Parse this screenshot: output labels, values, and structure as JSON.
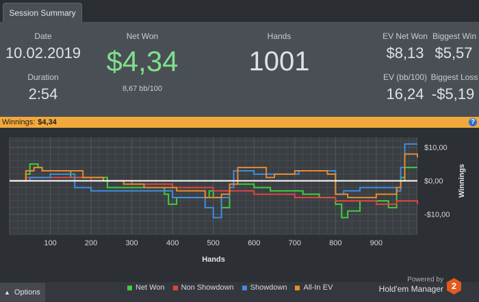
{
  "tab": {
    "label": "Session Summary"
  },
  "summary": {
    "date_label": "Date",
    "date": "10.02.2019",
    "duration_label": "Duration",
    "duration": "2:54",
    "netwon_label": "Net Won",
    "netwon": "$4,34",
    "netwon_sub": "8,67 bb/100",
    "hands_label": "Hands",
    "hands": "1001",
    "ev_net_won_label": "EV Net Won",
    "ev_net_won": "$8,13",
    "biggest_win_label": "Biggest Win",
    "biggest_win": "$5,57",
    "ev_bb100_label": "EV (bb/100)",
    "ev_bb100": "16,24",
    "biggest_loss_label": "Biggest Loss",
    "biggest_loss": "-$5,19"
  },
  "winnings_bar": {
    "label": "Winnings:",
    "value": "$4,34",
    "help": "?"
  },
  "chart_data": {
    "type": "line",
    "xlabel": "Hands",
    "ylabel": "Winnings",
    "xlim": [
      0,
      1001
    ],
    "ylim": [
      -16,
      13
    ],
    "x_ticks": [
      "100",
      "200",
      "300",
      "400",
      "500",
      "600",
      "700",
      "800",
      "900"
    ],
    "y_ticks": [
      "$10,00",
      "$0,00",
      "-$10,00"
    ],
    "grid": true,
    "legend_position": "bottom",
    "series": [
      {
        "name": "Net Won",
        "color": "#3fcf3a",
        "x": [
          0,
          40,
          50,
          70,
          80,
          150,
          240,
          380,
          390,
          410,
          450,
          490,
          500,
          520,
          540,
          550,
          600,
          640,
          700,
          720,
          760,
          800,
          815,
          830,
          860,
          900,
          930,
          950,
          960,
          970,
          1001
        ],
        "y": [
          0,
          2,
          5,
          4,
          3,
          1,
          -2,
          -4,
          -7,
          -5,
          -5,
          -3,
          -5,
          -8,
          -2,
          -1,
          -2,
          -3,
          -3,
          -4,
          -5,
          -7,
          -11,
          -9,
          -6,
          -6,
          -8,
          -2,
          1,
          4,
          4
        ]
      },
      {
        "name": "Non Showdown",
        "color": "#e0453e",
        "x": [
          0,
          40,
          100,
          200,
          300,
          380,
          400,
          450,
          500,
          540,
          600,
          700,
          750,
          800,
          850,
          900,
          950,
          1001
        ],
        "y": [
          0,
          1,
          1,
          0,
          -1,
          -1,
          -2,
          -2,
          -3,
          -3,
          -4,
          -5,
          -5,
          -6,
          -6,
          -7,
          -6,
          -7
        ]
      },
      {
        "name": "Showdown",
        "color": "#3d8ee0",
        "x": [
          0,
          50,
          100,
          160,
          200,
          380,
          400,
          440,
          480,
          500,
          520,
          540,
          550,
          600,
          700,
          710,
          800,
          820,
          860,
          900,
          950,
          960,
          970,
          1001
        ],
        "y": [
          0,
          1,
          2,
          -2,
          -3,
          -3,
          -5,
          -5,
          -8,
          -11,
          -5,
          -2,
          3,
          2,
          2,
          3,
          -4,
          -3,
          -2,
          -2,
          -3,
          4,
          11,
          11
        ]
      },
      {
        "name": "All-In EV",
        "color": "#e98a2f",
        "x": [
          0,
          40,
          60,
          80,
          120,
          180,
          230,
          280,
          330,
          380,
          410,
          480,
          520,
          540,
          560,
          600,
          630,
          650,
          700,
          720,
          780,
          800,
          830,
          900,
          950,
          960,
          970,
          1001
        ],
        "y": [
          0,
          3,
          4,
          3,
          3,
          1,
          0,
          -1,
          -2,
          -2,
          -3,
          -5,
          -4,
          -1,
          4,
          4,
          1,
          2,
          3,
          3,
          2,
          -4,
          -5,
          -4,
          -2,
          0,
          8,
          7
        ]
      }
    ]
  },
  "options": {
    "label": "Options",
    "icon": "caret-up-icon"
  },
  "branding": {
    "powered_by": "Powered by",
    "product": "Hold'em Manager",
    "logo": "2"
  }
}
